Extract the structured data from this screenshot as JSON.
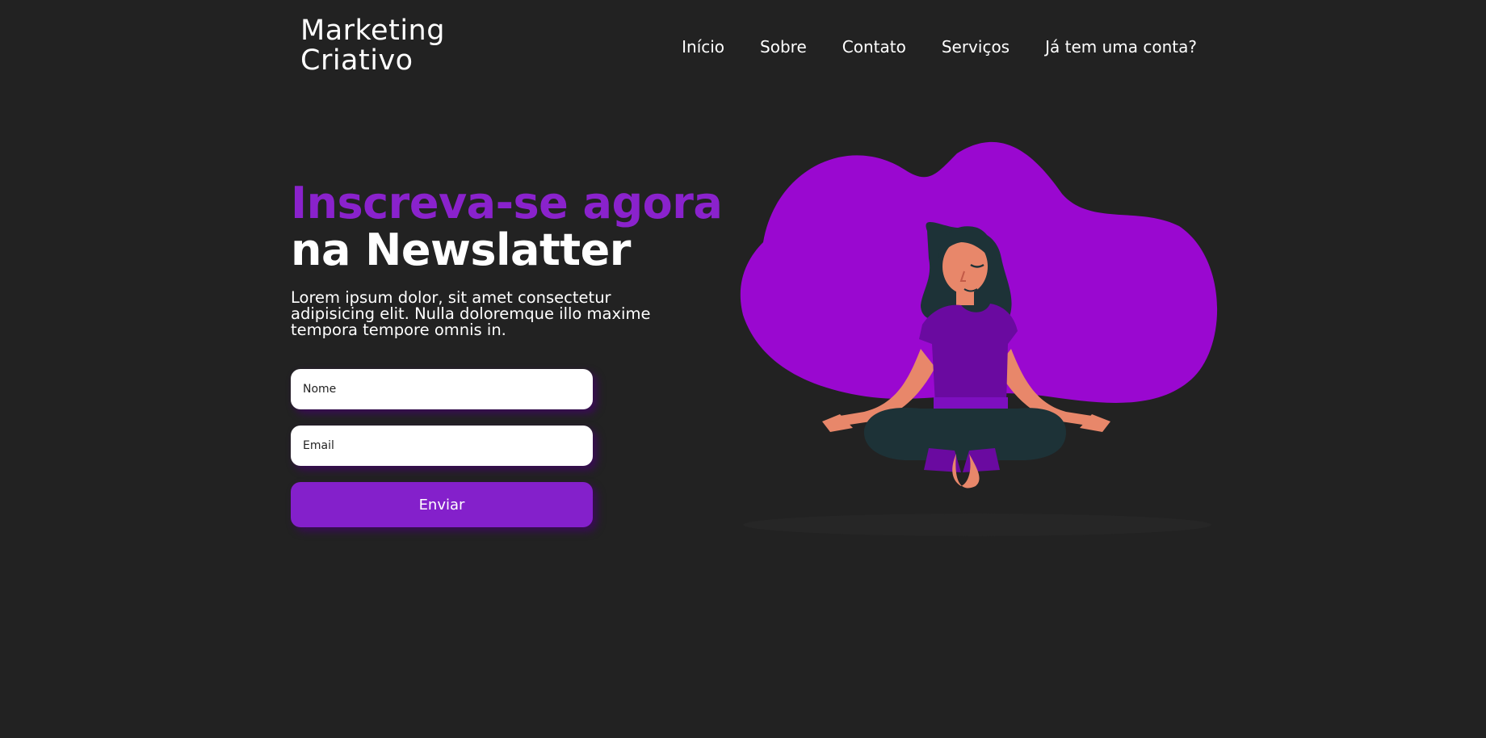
{
  "header": {
    "logo_line1": "Marketing",
    "logo_line2": "Criativo",
    "nav": [
      {
        "label": "Início"
      },
      {
        "label": "Sobre"
      },
      {
        "label": "Contato"
      },
      {
        "label": "Serviços"
      },
      {
        "label": "Já tem uma conta?"
      }
    ]
  },
  "hero": {
    "title_accent": "Inscreva-se agora",
    "title_main": "na Newslatter",
    "lead": "Lorem ipsum dolor, sit amet consectetur adipisicing elit. Nulla doloremque illo maxime tempora tempore omnis in."
  },
  "form": {
    "name_placeholder": "Nome",
    "email_placeholder": "Email",
    "submit_label": "Enviar"
  },
  "colors": {
    "background": "#222222",
    "accent": "#8a22cc",
    "blob": "#9a08d0",
    "button": "#8420cb"
  },
  "illustration": {
    "icon": "meditating-woman-illustration"
  }
}
